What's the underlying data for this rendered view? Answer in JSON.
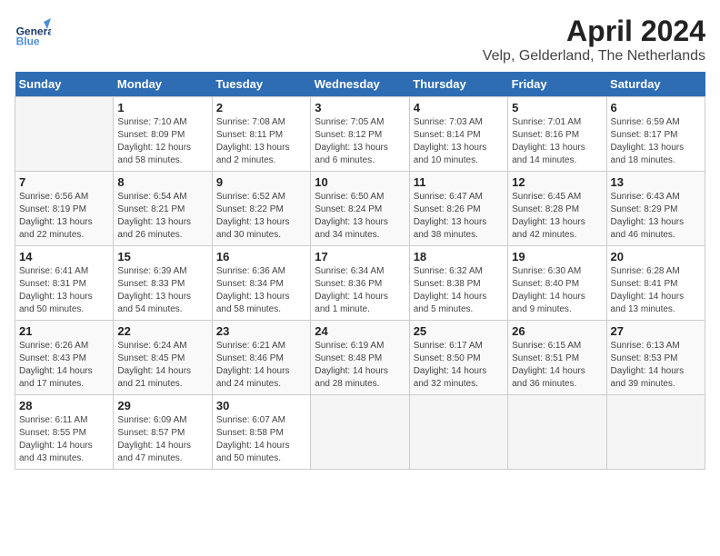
{
  "header": {
    "title": "April 2024",
    "subtitle": "Velp, Gelderland, The Netherlands",
    "logo_line1": "General",
    "logo_line2": "Blue"
  },
  "weekdays": [
    "Sunday",
    "Monday",
    "Tuesday",
    "Wednesday",
    "Thursday",
    "Friday",
    "Saturday"
  ],
  "weeks": [
    [
      {
        "day": "",
        "empty": true
      },
      {
        "day": "1",
        "sunrise": "7:10 AM",
        "sunset": "8:09 PM",
        "daylight": "12 hours and 58 minutes."
      },
      {
        "day": "2",
        "sunrise": "7:08 AM",
        "sunset": "8:11 PM",
        "daylight": "13 hours and 2 minutes."
      },
      {
        "day": "3",
        "sunrise": "7:05 AM",
        "sunset": "8:12 PM",
        "daylight": "13 hours and 6 minutes."
      },
      {
        "day": "4",
        "sunrise": "7:03 AM",
        "sunset": "8:14 PM",
        "daylight": "13 hours and 10 minutes."
      },
      {
        "day": "5",
        "sunrise": "7:01 AM",
        "sunset": "8:16 PM",
        "daylight": "13 hours and 14 minutes."
      },
      {
        "day": "6",
        "sunrise": "6:59 AM",
        "sunset": "8:17 PM",
        "daylight": "13 hours and 18 minutes."
      }
    ],
    [
      {
        "day": "7",
        "sunrise": "6:56 AM",
        "sunset": "8:19 PM",
        "daylight": "13 hours and 22 minutes."
      },
      {
        "day": "8",
        "sunrise": "6:54 AM",
        "sunset": "8:21 PM",
        "daylight": "13 hours and 26 minutes."
      },
      {
        "day": "9",
        "sunrise": "6:52 AM",
        "sunset": "8:22 PM",
        "daylight": "13 hours and 30 minutes."
      },
      {
        "day": "10",
        "sunrise": "6:50 AM",
        "sunset": "8:24 PM",
        "daylight": "13 hours and 34 minutes."
      },
      {
        "day": "11",
        "sunrise": "6:47 AM",
        "sunset": "8:26 PM",
        "daylight": "13 hours and 38 minutes."
      },
      {
        "day": "12",
        "sunrise": "6:45 AM",
        "sunset": "8:28 PM",
        "daylight": "13 hours and 42 minutes."
      },
      {
        "day": "13",
        "sunrise": "6:43 AM",
        "sunset": "8:29 PM",
        "daylight": "13 hours and 46 minutes."
      }
    ],
    [
      {
        "day": "14",
        "sunrise": "6:41 AM",
        "sunset": "8:31 PM",
        "daylight": "13 hours and 50 minutes."
      },
      {
        "day": "15",
        "sunrise": "6:39 AM",
        "sunset": "8:33 PM",
        "daylight": "13 hours and 54 minutes."
      },
      {
        "day": "16",
        "sunrise": "6:36 AM",
        "sunset": "8:34 PM",
        "daylight": "13 hours and 58 minutes."
      },
      {
        "day": "17",
        "sunrise": "6:34 AM",
        "sunset": "8:36 PM",
        "daylight": "14 hours and 1 minute."
      },
      {
        "day": "18",
        "sunrise": "6:32 AM",
        "sunset": "8:38 PM",
        "daylight": "14 hours and 5 minutes."
      },
      {
        "day": "19",
        "sunrise": "6:30 AM",
        "sunset": "8:40 PM",
        "daylight": "14 hours and 9 minutes."
      },
      {
        "day": "20",
        "sunrise": "6:28 AM",
        "sunset": "8:41 PM",
        "daylight": "14 hours and 13 minutes."
      }
    ],
    [
      {
        "day": "21",
        "sunrise": "6:26 AM",
        "sunset": "8:43 PM",
        "daylight": "14 hours and 17 minutes."
      },
      {
        "day": "22",
        "sunrise": "6:24 AM",
        "sunset": "8:45 PM",
        "daylight": "14 hours and 21 minutes."
      },
      {
        "day": "23",
        "sunrise": "6:21 AM",
        "sunset": "8:46 PM",
        "daylight": "14 hours and 24 minutes."
      },
      {
        "day": "24",
        "sunrise": "6:19 AM",
        "sunset": "8:48 PM",
        "daylight": "14 hours and 28 minutes."
      },
      {
        "day": "25",
        "sunrise": "6:17 AM",
        "sunset": "8:50 PM",
        "daylight": "14 hours and 32 minutes."
      },
      {
        "day": "26",
        "sunrise": "6:15 AM",
        "sunset": "8:51 PM",
        "daylight": "14 hours and 36 minutes."
      },
      {
        "day": "27",
        "sunrise": "6:13 AM",
        "sunset": "8:53 PM",
        "daylight": "14 hours and 39 minutes."
      }
    ],
    [
      {
        "day": "28",
        "sunrise": "6:11 AM",
        "sunset": "8:55 PM",
        "daylight": "14 hours and 43 minutes."
      },
      {
        "day": "29",
        "sunrise": "6:09 AM",
        "sunset": "8:57 PM",
        "daylight": "14 hours and 47 minutes."
      },
      {
        "day": "30",
        "sunrise": "6:07 AM",
        "sunset": "8:58 PM",
        "daylight": "14 hours and 50 minutes."
      },
      {
        "day": "",
        "empty": true
      },
      {
        "day": "",
        "empty": true
      },
      {
        "day": "",
        "empty": true
      },
      {
        "day": "",
        "empty": true
      }
    ]
  ]
}
